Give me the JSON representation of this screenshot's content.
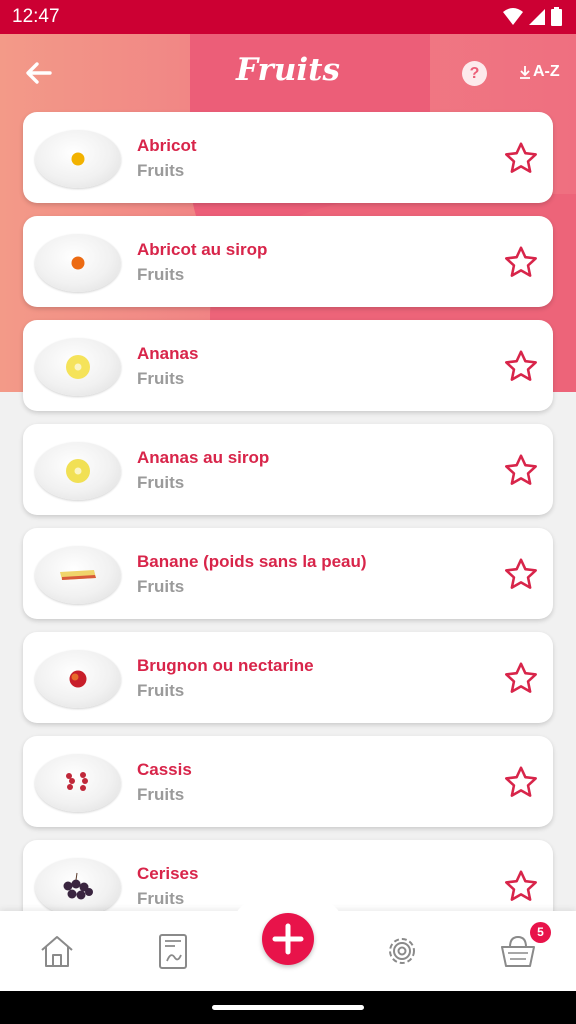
{
  "status_bar": {
    "time": "12:47"
  },
  "header": {
    "title": "Fruits",
    "help_label": "?",
    "sort_label": "A-Z"
  },
  "items": [
    {
      "name": "Abricot",
      "category": "Fruits"
    },
    {
      "name": "Abricot au sirop",
      "category": "Fruits"
    },
    {
      "name": "Ananas",
      "category": "Fruits"
    },
    {
      "name": "Ananas au sirop",
      "category": "Fruits"
    },
    {
      "name": "Banane (poids sans la peau)",
      "category": "Fruits"
    },
    {
      "name": "Brugnon ou nectarine",
      "category": "Fruits"
    },
    {
      "name": "Cassis",
      "category": "Fruits"
    },
    {
      "name": "Cerises",
      "category": "Fruits"
    }
  ],
  "bottom_nav": {
    "cart_badge": "5"
  },
  "colors": {
    "accent": "#e8134a",
    "status_bar": "#cc0033",
    "item_name": "#d8254a",
    "item_category": "#9a9a9a"
  },
  "icons": [
    "back-arrow-icon",
    "help-icon",
    "sort-icon",
    "star-icon",
    "home-icon",
    "journal-icon",
    "plus-icon",
    "gear-icon",
    "basket-icon"
  ]
}
